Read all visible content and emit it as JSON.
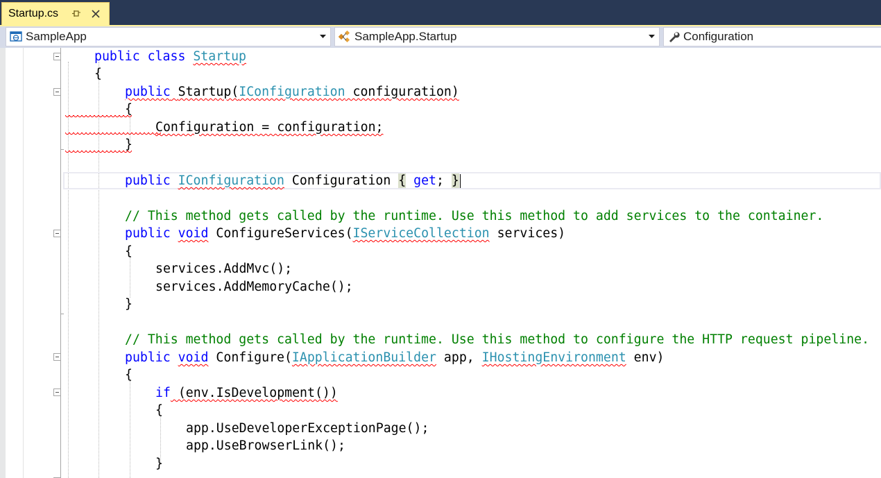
{
  "tab": {
    "title": "Startup.cs",
    "pin_icon": "pin-icon",
    "close_icon": "close-icon"
  },
  "navbar": {
    "project": "SampleApp",
    "type": "SampleApp.Startup",
    "member": "Configuration"
  },
  "colors": {
    "keyword": "#0000ff",
    "type": "#2b91af",
    "comment": "#008000",
    "squiggle": "#ff0000",
    "tab_active": "#fff29d",
    "chrome": "#293955"
  },
  "code": {
    "l1": {
      "kw": "public class",
      "type": "Startup"
    },
    "l2": "{",
    "l3": {
      "kw": "public",
      "name": "Startup(",
      "type": "IConfiguration",
      "rest": " configuration)"
    },
    "l4": "{",
    "l5": "Configuration = configuration;",
    "l6": "}",
    "l7": {
      "kw": "public",
      "type": "IConfiguration",
      "name": " Configuration ",
      "b1": "{",
      "kw2": " get",
      "semi": "; ",
      "b2": "}"
    },
    "l8": "// This method gets called by the runtime. Use this method to add services to the container.",
    "l9": {
      "kw": "public",
      "kw2": "void",
      "name": " ConfigureServices(",
      "type": "IServiceCollection",
      "rest": " services)"
    },
    "l10": "{",
    "l11": "services.AddMvc();",
    "l12": "services.AddMemoryCache();",
    "l13": "}",
    "l14": "// This method gets called by the runtime. Use this method to configure the HTTP request pipeline.",
    "l15": {
      "kw": "public",
      "kw2": "void",
      "name": " Configure(",
      "type1": "IApplicationBuilder",
      "mid": " app, ",
      "type2": "IHostingEnvironment",
      "rest": " env)"
    },
    "l16": "{",
    "l17": {
      "kw": "if",
      "rest": " (env.IsDevelopment())"
    },
    "l18": "{",
    "l19": "app.UseDeveloperExceptionPage();",
    "l20": "app.UseBrowserLink();",
    "l21": "}"
  }
}
